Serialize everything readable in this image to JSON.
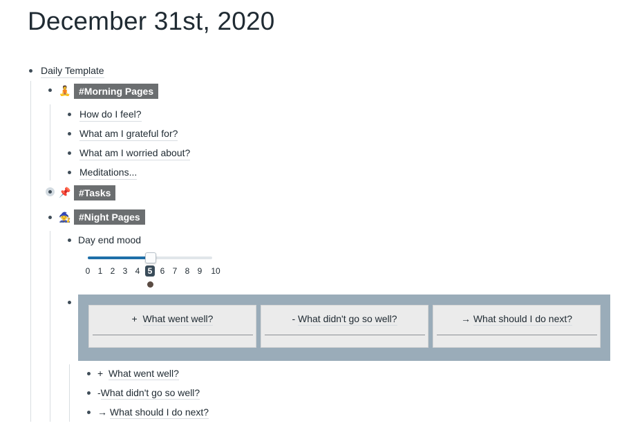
{
  "page": {
    "title": "December 31st, 2020"
  },
  "root": {
    "label": "Daily Template"
  },
  "morning": {
    "emoji": "🧘",
    "tag": "#Morning Pages",
    "items": [
      "How do I feel?",
      "What am I grateful for?",
      "What am I worried about?",
      "Meditations..."
    ]
  },
  "tasks": {
    "emoji": "📌",
    "tag": "#Tasks"
  },
  "night": {
    "emoji": "🧙",
    "tag": "#Night Pages",
    "mood_label": "Day end mood",
    "slider": {
      "min": 0,
      "max": 10,
      "value": 5,
      "ticks": [
        "0",
        "1",
        "2",
        "3",
        "4",
        "5",
        "6",
        "7",
        "8",
        "9",
        "10"
      ]
    }
  },
  "board": {
    "columns": [
      {
        "prefix": "+",
        "title": "What went well?"
      },
      {
        "prefix": "-",
        "title": "What didn't go so well?"
      },
      {
        "prefix": "→",
        "title": "What should I do next?"
      }
    ]
  },
  "children": [
    {
      "prefix": "+",
      "label": "What went well?"
    },
    {
      "prefix": "-",
      "label": "What didn't go so well?"
    },
    {
      "prefix": "→",
      "label": "What should I do next?"
    }
  ]
}
